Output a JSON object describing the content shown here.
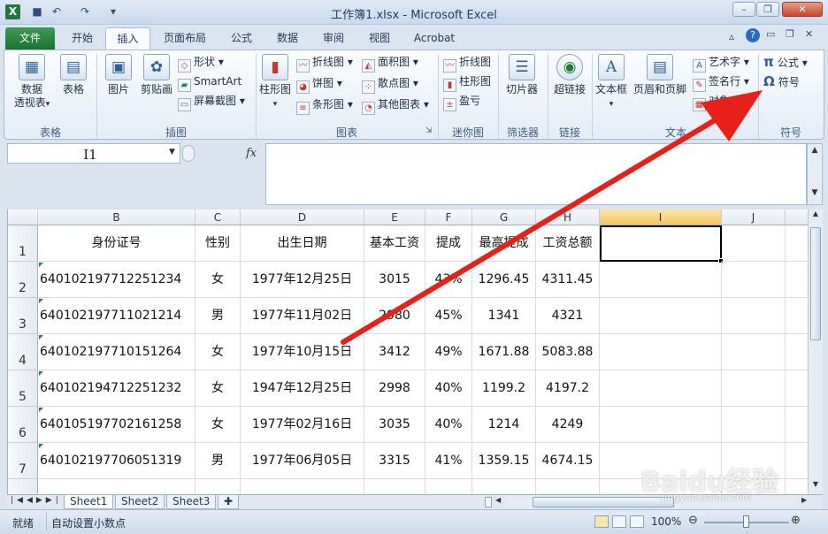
{
  "window": {
    "title": "工作簿1.xlsx - Microsoft Excel",
    "logo": "X",
    "min_icon": "minimize-icon",
    "max_icon": "restore-icon",
    "close_icon": "close-icon"
  },
  "tabs": [
    "文件",
    "开始",
    "插入",
    "页面布局",
    "公式",
    "数据",
    "审阅",
    "视图",
    "Acrobat"
  ],
  "ribbon": {
    "groups": {
      "tables": "表格",
      "illustrations": "插图",
      "charts": "图表",
      "sparklines": "迷你图",
      "filter": "筛选器",
      "links": "链接",
      "text": "文本",
      "symbols": "符号"
    },
    "buttons": {
      "pivot": "数据\n透视表",
      "table": "表格",
      "picture": "图片",
      "clipart": "剪贴画",
      "shapes": "形状",
      "smartart": "SmartArt",
      "screenshot": "屏幕截图",
      "column_chart": "柱形图",
      "line_chart": "折线图",
      "pie_chart": "饼图",
      "bar_chart": "条形图",
      "area_chart": "面积图",
      "scatter_chart": "散点图",
      "other_charts": "其他图表",
      "spark_line": "折线图",
      "spark_column": "柱形图",
      "spark_winloss": "盈亏",
      "slicer": "切片器",
      "hyperlink": "超链接",
      "textbox": "文本框",
      "header_footer": "页眉和页脚",
      "wordart": "艺术字",
      "signature": "签名行",
      "object": "对象",
      "equation": "公式",
      "symbol": "符号"
    }
  },
  "formula_bar": {
    "name_box": "I1",
    "fx": "fx",
    "content": ""
  },
  "columns": [
    "B",
    "C",
    "D",
    "E",
    "F",
    "G",
    "H",
    "I",
    "J"
  ],
  "rows": [
    "1",
    "2",
    "3",
    "4",
    "5",
    "6",
    "7"
  ],
  "table": {
    "headers": [
      "身份证号",
      "性别",
      "出生日期",
      "基本工资",
      "提成",
      "最高提成",
      "工资总额"
    ],
    "data": [
      [
        "640102197712251234",
        "女",
        "1977年12月25日",
        "3015",
        "43%",
        "1296.45",
        "4311.45"
      ],
      [
        "640102197711021214",
        "男",
        "1977年11月02日",
        "2980",
        "45%",
        "1341",
        "4321"
      ],
      [
        "640102197710151264",
        "女",
        "1977年10月15日",
        "3412",
        "49%",
        "1671.88",
        "5083.88"
      ],
      [
        "640102194712251232",
        "女",
        "1947年12月25日",
        "2998",
        "40%",
        "1199.2",
        "4197.2"
      ],
      [
        "640105197702161258",
        "女",
        "1977年02月16日",
        "3035",
        "40%",
        "1214",
        "4249"
      ],
      [
        "640102197706051319",
        "男",
        "1977年06月05日",
        "3315",
        "41%",
        "1359.15",
        "4674.15"
      ]
    ]
  },
  "sheets": [
    "Sheet1",
    "Sheet2",
    "Sheet3"
  ],
  "status": {
    "ready": "就绪",
    "auto_decimal": "自动设置小数点",
    "zoom": "100%"
  },
  "watermark": "Baidu经验",
  "watermark_url": "jingyan.baidu.com",
  "colors": {
    "file_tab": "#1e7033",
    "arrow": "#e8201a",
    "selected_col_header": "#f6d57a"
  }
}
